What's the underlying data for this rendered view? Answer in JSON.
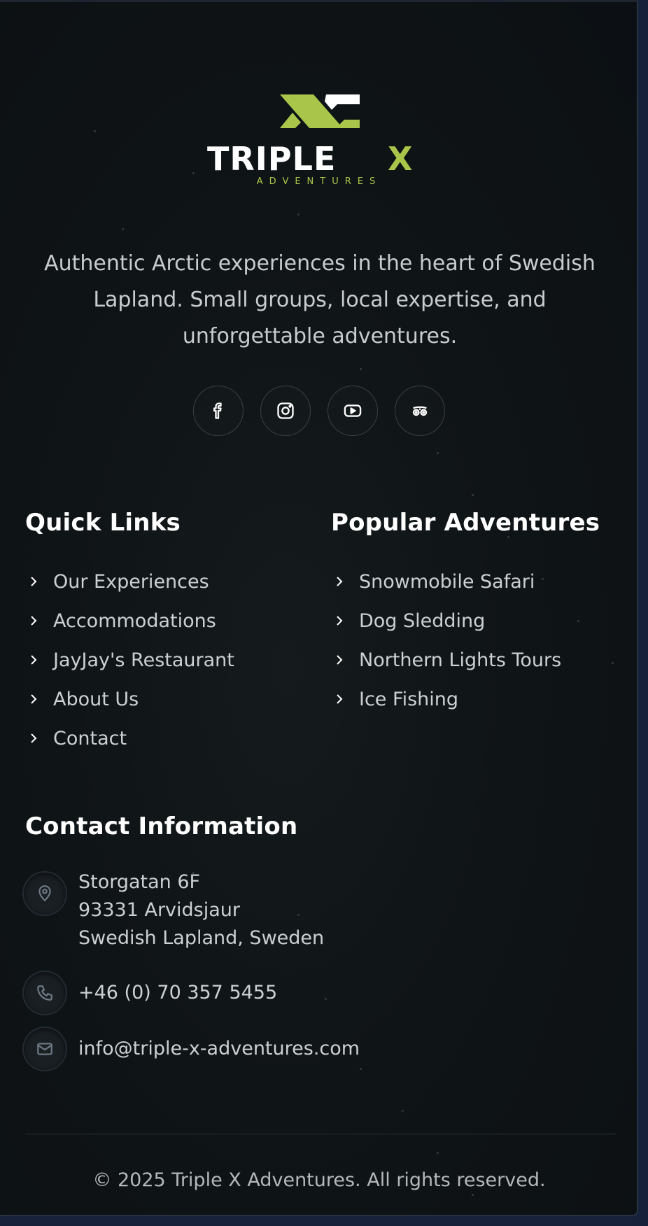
{
  "brand": {
    "name_part1": "TRIPLE",
    "name_part2": "X",
    "subtitle": "ADVENTURES",
    "accent_color": "#a9c64a"
  },
  "tagline": "Authentic Arctic experiences in the heart of Swedish Lapland. Small groups, local expertise, and unforgettable adventures.",
  "socials": [
    {
      "icon": "facebook-icon"
    },
    {
      "icon": "instagram-icon"
    },
    {
      "icon": "youtube-icon"
    },
    {
      "icon": "tripadvisor-icon"
    }
  ],
  "quick_links": {
    "title": "Quick Links",
    "items": [
      "Our Experiences",
      "Accommodations",
      "JayJay's Restaurant",
      "About Us",
      "Contact"
    ]
  },
  "popular": {
    "title": "Popular Adventures",
    "items": [
      "Snowmobile Safari",
      "Dog Sledding",
      "Northern Lights Tours",
      "Ice Fishing"
    ]
  },
  "contact": {
    "title": "Contact Information",
    "address_line1": "Storgatan 6F",
    "address_line2": "93331 Arvidsjaur",
    "address_line3": "Swedish Lapland, Sweden",
    "phone": "+46 (0) 70 357 5455",
    "email": "info@triple-x-adventures.com"
  },
  "copyright": "© 2025 Triple X Adventures. All rights reserved."
}
